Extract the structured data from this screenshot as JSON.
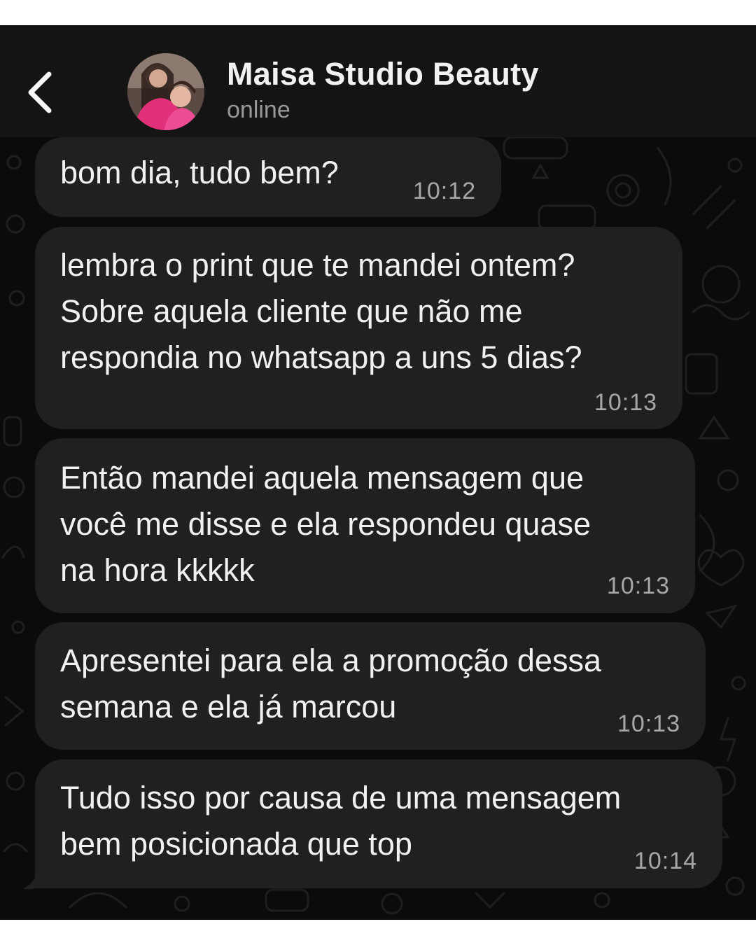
{
  "header": {
    "back_icon": "chevron-left-icon",
    "avatar_icon": "contact-avatar",
    "contact_name": "Maisa Studio Beauty",
    "status": "online"
  },
  "colors": {
    "background": "#0b0b0b",
    "header": "#141414",
    "bubble": "#202020",
    "text": "#f1f1f1",
    "timestamp": "#a7a7a7",
    "accent_avatar": "#e0307a"
  },
  "messages": [
    {
      "lines": [
        "bom dia, tudo bem?"
      ],
      "time": "10:12"
    },
    {
      "lines": [
        "lembra o print que te mandei ontem?",
        "Sobre aquela cliente que não me",
        "respondia no whatsapp a uns 5 dias?"
      ],
      "time": "10:13"
    },
    {
      "lines": [
        "Então mandei aquela mensagem que",
        "você me disse e ela respondeu quase",
        "na hora kkkkk"
      ],
      "time": "10:13"
    },
    {
      "lines": [
        "Apresentei para ela a promoção dessa",
        "semana e ela já marcou"
      ],
      "time": "10:13"
    },
    {
      "lines": [
        "Tudo isso por causa de uma mensagem",
        "bem posicionada que top"
      ],
      "time": "10:14"
    }
  ]
}
